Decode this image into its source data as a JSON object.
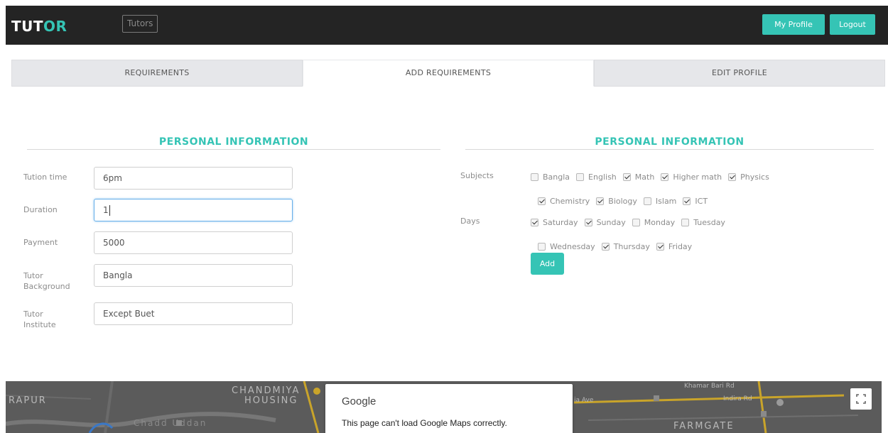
{
  "header": {
    "logo_main": "TUT",
    "logo_accent": "OR",
    "nav_tutors": "Tutors",
    "my_profile": "My Profile",
    "logout": "Logout"
  },
  "tabs": [
    "REQUIREMENTS",
    "ADD REQUIREMENTS",
    "EDIT PROFILE"
  ],
  "left": {
    "title": "PERSONAL INFORMATION",
    "fields": [
      {
        "label": "Tution time",
        "value": "6pm"
      },
      {
        "label": "Duration",
        "value": "1"
      },
      {
        "label": "Payment",
        "value": "5000"
      },
      {
        "label_line1": "Tutor",
        "label_line2": "Background",
        "value": "Bangla"
      },
      {
        "label_line1": "Tutor",
        "label_line2": "Institute",
        "value": "Except Buet"
      }
    ]
  },
  "right": {
    "title": "PERSONAL INFORMATION",
    "subjects_label": "Subjects",
    "subjects": [
      {
        "label": "Bangla",
        "checked": false
      },
      {
        "label": "English",
        "checked": false
      },
      {
        "label": "Math",
        "checked": true
      },
      {
        "label": "Higher math",
        "checked": true
      },
      {
        "label": "Physics",
        "checked": true
      },
      {
        "label": "Chemistry",
        "checked": true
      },
      {
        "label": "Biology",
        "checked": true
      },
      {
        "label": "Islam",
        "checked": false
      },
      {
        "label": "ICT",
        "checked": true
      }
    ],
    "days_label": "Days",
    "days": [
      {
        "label": "Saturday",
        "checked": true
      },
      {
        "label": "Sunday",
        "checked": true
      },
      {
        "label": "Monday",
        "checked": false
      },
      {
        "label": "Tuesday",
        "checked": false
      },
      {
        "label": "Wednesday",
        "checked": false
      },
      {
        "label": "Thursday",
        "checked": true
      },
      {
        "label": "Friday",
        "checked": true
      }
    ],
    "add_button": "Add"
  },
  "map": {
    "labels": {
      "rapur": "RAPUR",
      "chandmiya_1": "CHANDMIYA",
      "chandmiya_2": "HOUSING",
      "chadd": "Chadd Uddan",
      "ave": "ia Ave",
      "khamar": "Khamar Bari Rd",
      "indira": "Indira Rd",
      "farmgate": "FARMGATE"
    },
    "dialog_brand": "Google",
    "dialog_message": "This page can't load Google Maps correctly."
  },
  "colors": {
    "accent": "#35c4b5",
    "header_bg": "#242424",
    "tab_bg": "#e6e7ea"
  }
}
